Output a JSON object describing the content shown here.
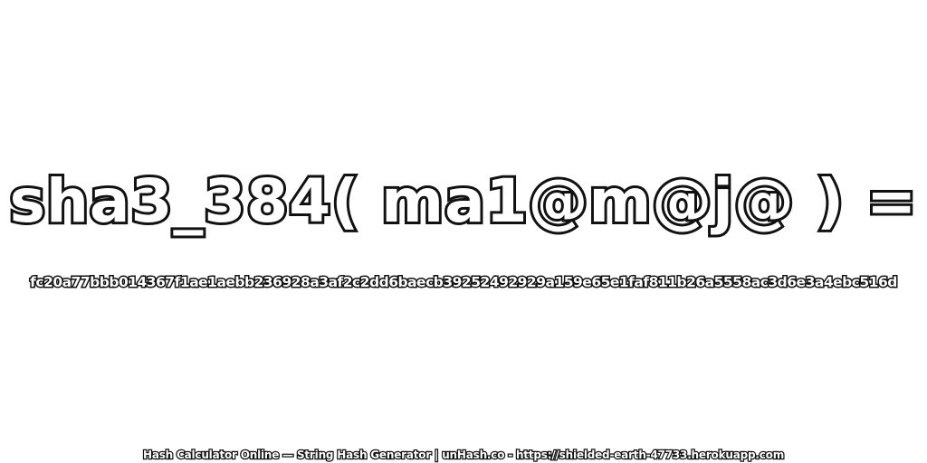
{
  "expression": "sha3_384( ma1@m@j@ ) =",
  "hash_value": "fc20a77bbb014367f1ae1aebb236928a3af2c2dd6baecb39252492929a159e65e1faf811b26a5558ac3d6e3a4ebc516d",
  "footer": "Hash Calculator Online — String Hash Generator | unHash.co - https://shielded-earth-47733.herokuapp.com",
  "colors": {
    "text_fill": "#ffffff",
    "text_outline": "#111111",
    "background": "#ffffff"
  }
}
